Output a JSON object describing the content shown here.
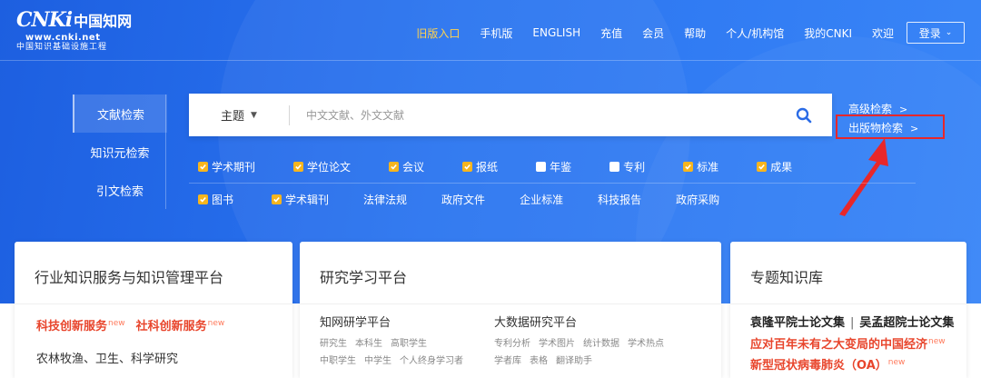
{
  "logo": {
    "mark": "CNKi",
    "mark_cn": "中国知网",
    "url": "www.cnki.net",
    "subtitle": "中国知识基础设施工程"
  },
  "topnav": {
    "items": [
      "旧版入口",
      "手机版",
      "ENGLISH",
      "充值",
      "会员",
      "帮助",
      "个人/机构馆",
      "我的CNKI",
      "欢迎"
    ],
    "login_label": "登录"
  },
  "search_tabs": [
    "文献检索",
    "知识元检索",
    "引文检索"
  ],
  "search": {
    "field_label": "主题",
    "placeholder": "中文文献、外文文献"
  },
  "adv_links": [
    "高级检索",
    "出版物检索"
  ],
  "databases": {
    "row1": [
      {
        "label": "学术期刊",
        "checked": true
      },
      {
        "label": "学位论文",
        "checked": true
      },
      {
        "label": "会议",
        "checked": true
      },
      {
        "label": "报纸",
        "checked": true
      },
      {
        "label": "年鉴",
        "checked": false
      },
      {
        "label": "专利",
        "checked": false
      },
      {
        "label": "标准",
        "checked": true
      },
      {
        "label": "成果",
        "checked": true
      }
    ],
    "row2": [
      {
        "label": "图书",
        "checked": true
      },
      {
        "label": "学术辑刊",
        "checked": true
      },
      {
        "label": "法律法规",
        "checked": null
      },
      {
        "label": "政府文件",
        "checked": null
      },
      {
        "label": "企业标准",
        "checked": null
      },
      {
        "label": "科技报告",
        "checked": null
      },
      {
        "label": "政府采购",
        "checked": null
      }
    ]
  },
  "cards": {
    "industry": {
      "title": "行业知识服务与知识管理平台",
      "hot_links": [
        "科技创新服务",
        "社科创新服务"
      ],
      "new_tag": "new",
      "subjects": "农林牧渔、卫生、科学研究"
    },
    "research": {
      "title": "研究学习平台",
      "platforms": [
        {
          "title": "知网研学平台",
          "links": [
            [
              "研究生",
              "本科生",
              "高职学生"
            ],
            [
              "中职学生",
              "中学生",
              "个人终身学习者"
            ]
          ]
        },
        {
          "title": "大数据研究平台",
          "links": [
            [
              "专利分析",
              "学术图片",
              "统计数据",
              "学术热点"
            ],
            [
              "学者库",
              "表格",
              "翻译助手"
            ]
          ]
        }
      ]
    },
    "topics": {
      "title": "专题知识库",
      "line1_a": "袁隆平院士论文集",
      "line1_b": "吴孟超院士论文集",
      "line2": "应对百年未有之大变局的中国经济",
      "line3": "新型冠状病毒肺炎（OA）",
      "new_tag": "new"
    }
  },
  "colors": {
    "banner": "#2a74f0",
    "checkbox_on": "#f6b51e",
    "highlight_red": "#e8272a",
    "hot_text": "#e8452c",
    "old_entry": "#ffd24d"
  }
}
